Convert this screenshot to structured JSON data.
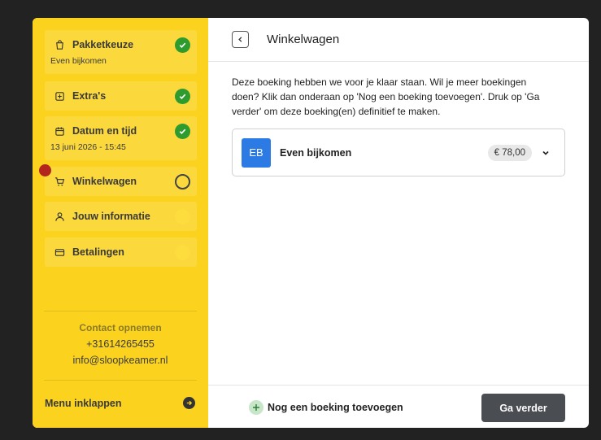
{
  "sidebar": {
    "steps": [
      {
        "label": "Pakketkeuze",
        "sub": "Even bijkomen",
        "status": "done",
        "icon": "bag-icon"
      },
      {
        "label": "Extra's",
        "sub": "",
        "status": "done",
        "icon": "plus-box-icon"
      },
      {
        "label": "Datum en tijd",
        "sub": "13 juni 2026 - 15:45",
        "status": "done",
        "icon": "calendar-icon"
      },
      {
        "label": "Winkelwagen",
        "sub": "",
        "status": "current",
        "icon": "cart-icon"
      },
      {
        "label": "Jouw informatie",
        "sub": "",
        "status": "todo",
        "icon": "person-icon"
      },
      {
        "label": "Betalingen",
        "sub": "",
        "status": "todo",
        "icon": "card-icon"
      }
    ],
    "contact": {
      "title": "Contact opnemen",
      "phone": "+31614265455",
      "email": "info@sloopkeamer.nl"
    },
    "collapse_label": "Menu inklappen"
  },
  "main": {
    "title": "Winkelwagen",
    "intro": "Deze boeking hebben we voor je klaar staan. Wil je meer boekingen doen? Klik dan onderaan op 'Nog een boeking toevoegen'. Druk op 'Ga verder' om deze boeking(en) definitief te maken.",
    "booking": {
      "initials": "EB",
      "name": "Even bijkomen",
      "price": "€ 78,00"
    }
  },
  "footer": {
    "add_label": "Nog een boeking toevoegen",
    "next_label": "Ga verder"
  },
  "colors": {
    "sidebar": "#fbd31f",
    "done": "#2e9b2e",
    "avatar": "#2c7be5",
    "primary_button": "#4a4d52",
    "marker": "#b3261e"
  }
}
